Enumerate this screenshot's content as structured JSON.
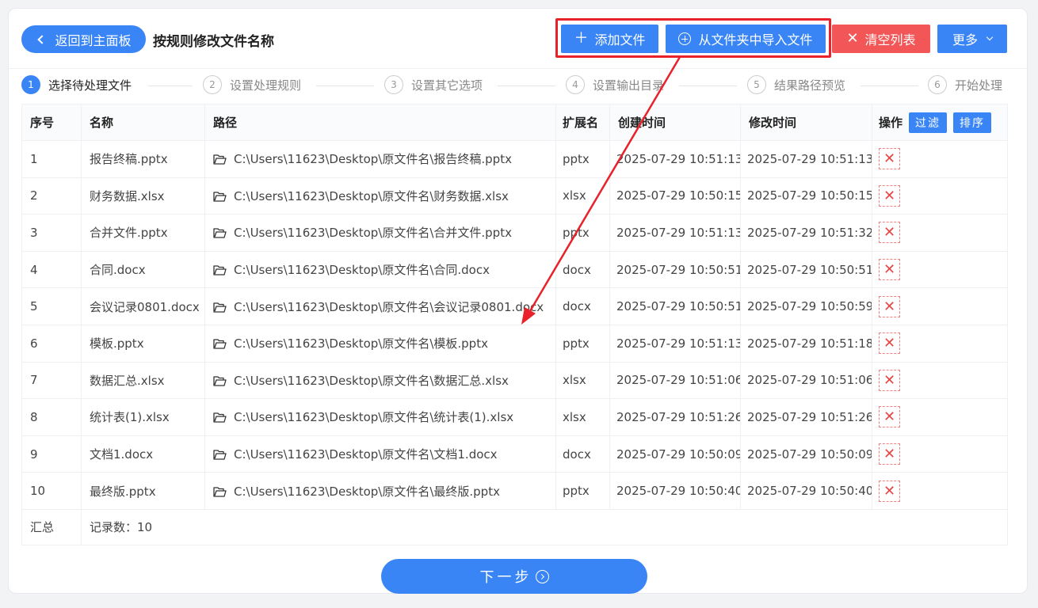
{
  "header": {
    "back_label": "返回到主面板",
    "title": "按规则修改文件名称",
    "add_file_label": "添加文件",
    "import_folder_label": "从文件夹中导入文件",
    "clear_list_label": "清空列表",
    "more_label": "更多"
  },
  "steps": [
    {
      "num": "1",
      "label": "选择待处理文件"
    },
    {
      "num": "2",
      "label": "设置处理规则"
    },
    {
      "num": "3",
      "label": "设置其它选项"
    },
    {
      "num": "4",
      "label": "设置输出目录"
    },
    {
      "num": "5",
      "label": "结果路径预览"
    },
    {
      "num": "6",
      "label": "开始处理"
    }
  ],
  "table": {
    "headers": {
      "index": "序号",
      "name": "名称",
      "path": "路径",
      "ext": "扩展名",
      "created": "创建时间",
      "modified": "修改时间",
      "action": "操作",
      "filter_label": "过滤",
      "sort_label": "排序"
    },
    "rows": [
      {
        "index": "1",
        "name": "报告终稿.pptx",
        "path": "C:\\Users\\11623\\Desktop\\原文件名\\报告终稿.pptx",
        "ext": "pptx",
        "created": "2025-07-29 10:51:13",
        "modified": "2025-07-29 10:51:13"
      },
      {
        "index": "2",
        "name": "财务数据.xlsx",
        "path": "C:\\Users\\11623\\Desktop\\原文件名\\财务数据.xlsx",
        "ext": "xlsx",
        "created": "2025-07-29 10:50:15",
        "modified": "2025-07-29 10:50:15"
      },
      {
        "index": "3",
        "name": "合并文件.pptx",
        "path": "C:\\Users\\11623\\Desktop\\原文件名\\合并文件.pptx",
        "ext": "pptx",
        "created": "2025-07-29 10:51:13",
        "modified": "2025-07-29 10:51:32"
      },
      {
        "index": "4",
        "name": "合同.docx",
        "path": "C:\\Users\\11623\\Desktop\\原文件名\\合同.docx",
        "ext": "docx",
        "created": "2025-07-29 10:50:51",
        "modified": "2025-07-29 10:50:51"
      },
      {
        "index": "5",
        "name": "会议记录0801.docx",
        "path": "C:\\Users\\11623\\Desktop\\原文件名\\会议记录0801.docx",
        "ext": "docx",
        "created": "2025-07-29 10:50:51",
        "modified": "2025-07-29 10:50:59"
      },
      {
        "index": "6",
        "name": "模板.pptx",
        "path": "C:\\Users\\11623\\Desktop\\原文件名\\模板.pptx",
        "ext": "pptx",
        "created": "2025-07-29 10:51:13",
        "modified": "2025-07-29 10:51:18"
      },
      {
        "index": "7",
        "name": "数据汇总.xlsx",
        "path": "C:\\Users\\11623\\Desktop\\原文件名\\数据汇总.xlsx",
        "ext": "xlsx",
        "created": "2025-07-29 10:51:06",
        "modified": "2025-07-29 10:51:06"
      },
      {
        "index": "8",
        "name": "统计表(1).xlsx",
        "path": "C:\\Users\\11623\\Desktop\\原文件名\\统计表(1).xlsx",
        "ext": "xlsx",
        "created": "2025-07-29 10:51:26",
        "modified": "2025-07-29 10:51:26"
      },
      {
        "index": "9",
        "name": "文档1.docx",
        "path": "C:\\Users\\11623\\Desktop\\原文件名\\文档1.docx",
        "ext": "docx",
        "created": "2025-07-29 10:50:09",
        "modified": "2025-07-29 10:50:09"
      },
      {
        "index": "10",
        "name": "最终版.pptx",
        "path": "C:\\Users\\11623\\Desktop\\原文件名\\最终版.pptx",
        "ext": "pptx",
        "created": "2025-07-29 10:50:40",
        "modified": "2025-07-29 10:50:40"
      }
    ],
    "summary_label": "汇总",
    "summary_value": "记录数：10"
  },
  "footer": {
    "next_label": "下一步"
  },
  "colors": {
    "primary": "#3a85f5",
    "danger": "#f25656",
    "highlight": "#e8212a"
  },
  "icons": {
    "back": "chevron-left-icon",
    "add": "plus-icon",
    "import": "circle-plus-icon",
    "clear": "close-icon",
    "more": "chevron-down-icon",
    "folder": "folder-icon",
    "delete": "close-icon",
    "next": "circle-arrow-right-icon"
  }
}
